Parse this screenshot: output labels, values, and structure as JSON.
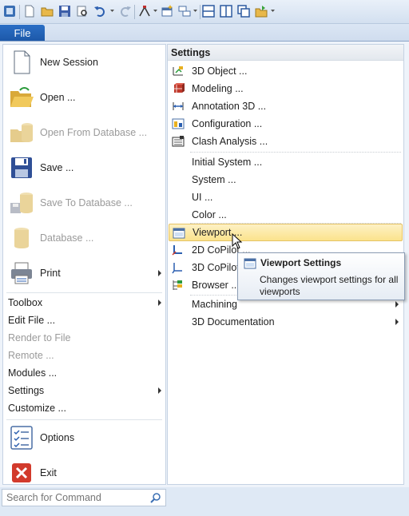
{
  "file_tab": {
    "label": "File"
  },
  "left_menu": {
    "big_items": [
      {
        "label": "New Session",
        "icon": "new-document-icon",
        "enabled": true
      },
      {
        "label": "Open ...",
        "icon": "open-folder-icon",
        "enabled": true
      },
      {
        "label": "Open From Database ...",
        "icon": "open-database-icon",
        "enabled": false
      },
      {
        "label": "Save ...",
        "icon": "floppy-disk-icon",
        "enabled": true
      },
      {
        "label": "Save To Database ...",
        "icon": "save-database-icon",
        "enabled": false
      },
      {
        "label": "Database ...",
        "icon": "database-icon",
        "enabled": false
      },
      {
        "label": "Print",
        "icon": "printer-icon",
        "enabled": true,
        "has_submenu": true
      }
    ],
    "small_items": [
      {
        "label": "Toolbox",
        "enabled": true,
        "has_submenu": true
      },
      {
        "label": "Edit File ...",
        "enabled": true,
        "has_submenu": false
      },
      {
        "label": "Render to File",
        "enabled": false,
        "has_submenu": false
      },
      {
        "label": "Remote ...",
        "enabled": false,
        "has_submenu": false
      },
      {
        "label": "Modules ...",
        "enabled": true,
        "has_submenu": false
      },
      {
        "label": "Settings",
        "enabled": true,
        "has_submenu": true
      },
      {
        "label": "Customize ...",
        "enabled": true,
        "has_submenu": false
      }
    ],
    "options_label": "Options",
    "exit_label": "Exit"
  },
  "settings": {
    "header": "Settings",
    "group1": [
      {
        "label": "3D Object ...",
        "icon": "3d-object-icon"
      },
      {
        "label": "Modeling ...",
        "icon": "modeling-icon"
      },
      {
        "label": "Annotation 3D ...",
        "icon": "annotation-3d-icon"
      },
      {
        "label": "Configuration ...",
        "icon": "configuration-icon"
      },
      {
        "label": "Clash Analysis ...",
        "icon": "clash-analysis-icon"
      }
    ],
    "group2": [
      {
        "label": "Initial System ..."
      },
      {
        "label": "System ..."
      },
      {
        "label": "UI ..."
      },
      {
        "label": "Color ..."
      }
    ],
    "group3": [
      {
        "label": "Viewport ...",
        "icon": "viewport-icon",
        "highlighted": true
      },
      {
        "label": "2D CoPilot ...",
        "icon": "2d-copilot-icon"
      },
      {
        "label": "3D CoPilot ...",
        "icon": "3d-copilot-icon"
      },
      {
        "label": "Browser ...",
        "icon": "browser-icon"
      }
    ],
    "group4": [
      {
        "label": "Machining",
        "has_submenu": true
      },
      {
        "label": "3D Documentation",
        "has_submenu": true
      }
    ]
  },
  "tooltip": {
    "title": "Viewport Settings",
    "description": "Changes viewport settings for all viewports"
  },
  "search": {
    "placeholder": "Search for Command"
  },
  "colors": {
    "file_tab": "#1c57a8",
    "hover_highlight": "#fbe38c",
    "disabled_text": "#9a9a9a"
  }
}
